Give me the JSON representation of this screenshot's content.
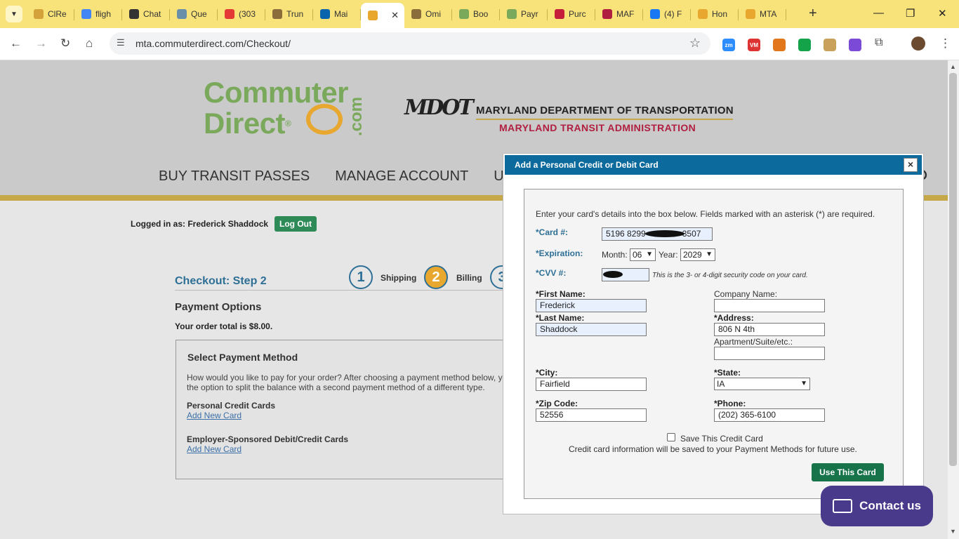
{
  "browser": {
    "tabs": [
      {
        "label": "ClRe",
        "color": "#d4a23a"
      },
      {
        "label": "fligh",
        "color": "#4285f4"
      },
      {
        "label": "Chat",
        "color": "#333333"
      },
      {
        "label": "Que",
        "color": "#6a8fa8"
      },
      {
        "label": "(303",
        "color": "#e53935"
      },
      {
        "label": "Trun",
        "color": "#8a6d3b"
      },
      {
        "label": "Mai",
        "color": "#0a64ad"
      },
      {
        "label": "",
        "color": "#e8a830"
      },
      {
        "label": "Omi",
        "color": "#8a6d3b"
      },
      {
        "label": "Boo",
        "color": "#7aa95c"
      },
      {
        "label": "Payr",
        "color": "#7aa95c"
      },
      {
        "label": "Purc",
        "color": "#c41e3a"
      },
      {
        "label": "MAF",
        "color": "#b01e40"
      },
      {
        "label": "(4) F",
        "color": "#1877f2"
      },
      {
        "label": "Hon",
        "color": "#e8a830"
      },
      {
        "label": "MTA",
        "color": "#e8a830"
      }
    ],
    "url": "mta.commuterdirect.com/Checkout/",
    "extensions": [
      {
        "name": "zoom-extension-icon",
        "color": "#2d8cff",
        "text": "zm"
      },
      {
        "name": "vm-extension-icon",
        "color": "#d33",
        "text": "VM"
      },
      {
        "name": "metamask-extension-icon",
        "color": "#e2761b",
        "text": ""
      },
      {
        "name": "grammarly-extension-icon",
        "color": "#15a34a",
        "text": ""
      },
      {
        "name": "extension-icon",
        "color": "#c9a15a",
        "text": ""
      },
      {
        "name": "twitch-extension-icon",
        "color": "#7b4bd8",
        "text": ""
      }
    ]
  },
  "site": {
    "logo_line1": "Commuter",
    "logo_line2": "Direct",
    "logo_reg": "®",
    "logo_com": ".com",
    "mdot_mark": "MDOT",
    "mdot_line1": "MARYLAND DEPARTMENT OF TRANSPORTATION",
    "mdot_line2": "MARYLAND TRANSIT ADMINISTRATION",
    "nav": [
      "BUY TRANSIT PASSES",
      "MANAGE ACCOUNT",
      "U"
    ],
    "logged_in": "Logged in as: Frederick Shaddock",
    "logout": "Log Out"
  },
  "checkout": {
    "title": "Checkout: Step 2",
    "steps": [
      {
        "num": "1",
        "label": "Shipping"
      },
      {
        "num": "2",
        "label": "Billing"
      },
      {
        "num": "3",
        "label": ""
      }
    ],
    "payment_options": "Payment Options",
    "order_total": "Your order total is $8.00.",
    "select_title": "Select Payment Method",
    "select_desc": "How would you like to pay for your order? After choosing a payment method below, y the option to split the balance with a second payment method of a different type.",
    "personal_label": "Personal Credit Cards",
    "personal_link": "Add New Card",
    "employer_label": "Employer-Sponsored Debit/Credit Cards",
    "employer_link": "Add New Card"
  },
  "modal": {
    "title": "Add a Personal Credit or Debit Card",
    "close": "×",
    "intro": "Enter your card's details into the box below. Fields marked with an asterisk (*) are required.",
    "card_label": "*Card #:",
    "card_value": "5196 8299",
    "card_value_end": "3507",
    "expiration_label": "*Expiration:",
    "month_label": "Month:",
    "month_value": "06",
    "year_label": "Year:",
    "year_value": "2029",
    "cvv_label": "*CVV #:",
    "cvv_hint": "This is the 3- or 4-digit security code on your card.",
    "first_name_label": "*First Name:",
    "first_name": "Frederick",
    "last_name_label": "*Last Name:",
    "last_name": "Shaddock",
    "company_label": "Company Name:",
    "company": "",
    "address_label": "*Address:",
    "address": "806 N 4th",
    "apt_label": "Apartment/Suite/etc.:",
    "apt": "",
    "city_label": "*City:",
    "city": "Fairfield",
    "state_label": "*State:",
    "state": "IA",
    "zip_label": "*Zip Code:",
    "zip": "52556",
    "phone_label": "*Phone:",
    "phone": "(202) 365-6100",
    "save_label": "Save This Credit Card",
    "save_note": "Credit card information will be saved to your Payment Methods for future use.",
    "use_button": "Use This Card"
  },
  "contact": "Contact us"
}
